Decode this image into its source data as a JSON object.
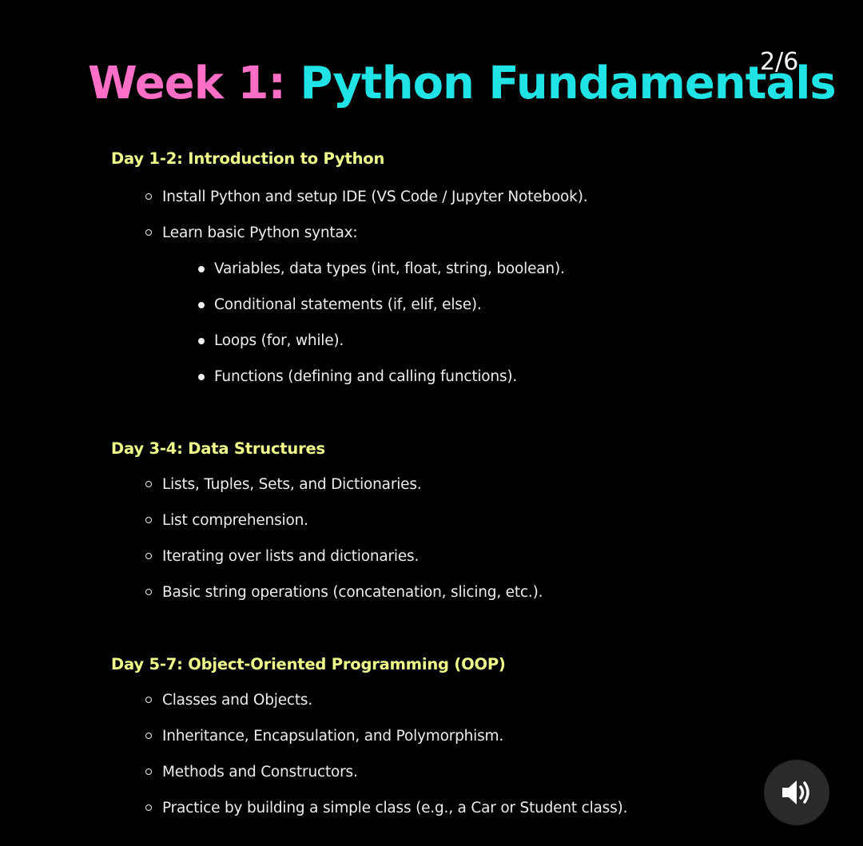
{
  "slide": {
    "title_part1": "Week 1:",
    "title_part2": "Python Fundamentals",
    "counter": "2/6"
  },
  "sections": [
    {
      "heading": "Day 1-2: Introduction to Python",
      "items": [
        "Install Python and setup IDE (VS Code / Jupyter Notebook).",
        "Learn basic Python syntax:"
      ],
      "subitems": [
        "Variables, data types (int, float, string, boolean).",
        "Conditional statements (if, elif, else).",
        "Loops (for, while).",
        "Functions (defining and calling functions)."
      ]
    },
    {
      "heading": "Day 3-4: Data Structures",
      "items": [
        "Lists, Tuples, Sets, and Dictionaries.",
        "List comprehension.",
        "Iterating over lists and dictionaries.",
        "Basic string operations (concatenation, slicing, etc.)."
      ]
    },
    {
      "heading": "Day 5-7: Object-Oriented Programming (OOP)",
      "items": [
        "Classes and Objects.",
        "Inheritance, Encapsulation, and Polymorphism.",
        "Methods and Constructors.",
        "Practice by building a simple class (e.g., a Car or Student class)."
      ]
    }
  ],
  "controls": {
    "audio_icon": "speaker-volume-icon"
  },
  "colors": {
    "background": "#000000",
    "title_part1": "#ff6ec7",
    "title_part2": "#20e3e6",
    "heading": "#f1ff8a",
    "text": "#eeeeee"
  }
}
